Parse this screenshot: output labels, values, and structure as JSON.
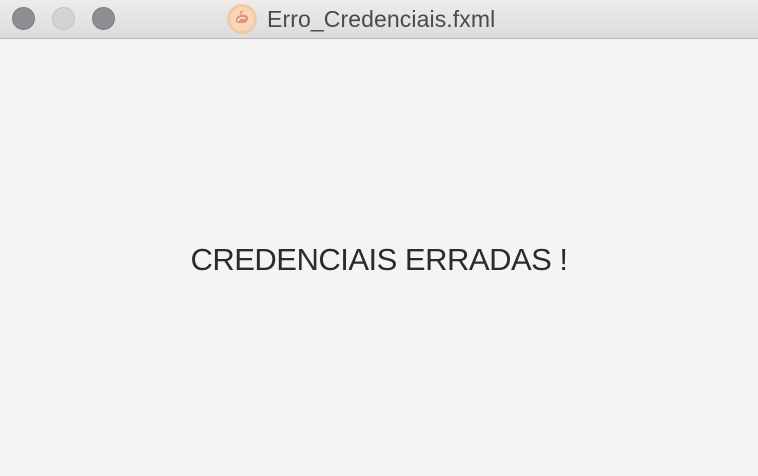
{
  "window": {
    "title": "Erro_Credenciais.fxml",
    "controls": {
      "close": "close-button",
      "minimize": "minimize-button",
      "zoom": "zoom-button"
    },
    "icon": "java-app-icon"
  },
  "content": {
    "message": "CREDENCIAIS ERRADAS !"
  },
  "colors": {
    "background": "#f4f4f4",
    "titlebar": "#e2e2e2",
    "traffic_inactive": "#8e8d92",
    "text": "#2b2b2b"
  }
}
